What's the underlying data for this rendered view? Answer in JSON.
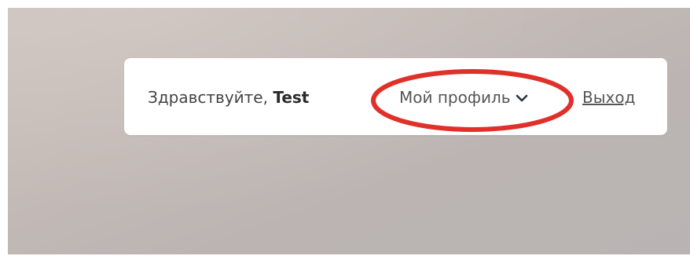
{
  "header": {
    "greeting_prefix": "Здравствуйте,",
    "user_name": "Test",
    "profile_menu_label": "Мой профиль",
    "logout_label": "Выход"
  },
  "icons": {
    "profile_menu": "chevron-down-icon"
  },
  "colors": {
    "highlight": "#e0302a",
    "background": "#c4bbb7",
    "panel": "#ffffff"
  }
}
